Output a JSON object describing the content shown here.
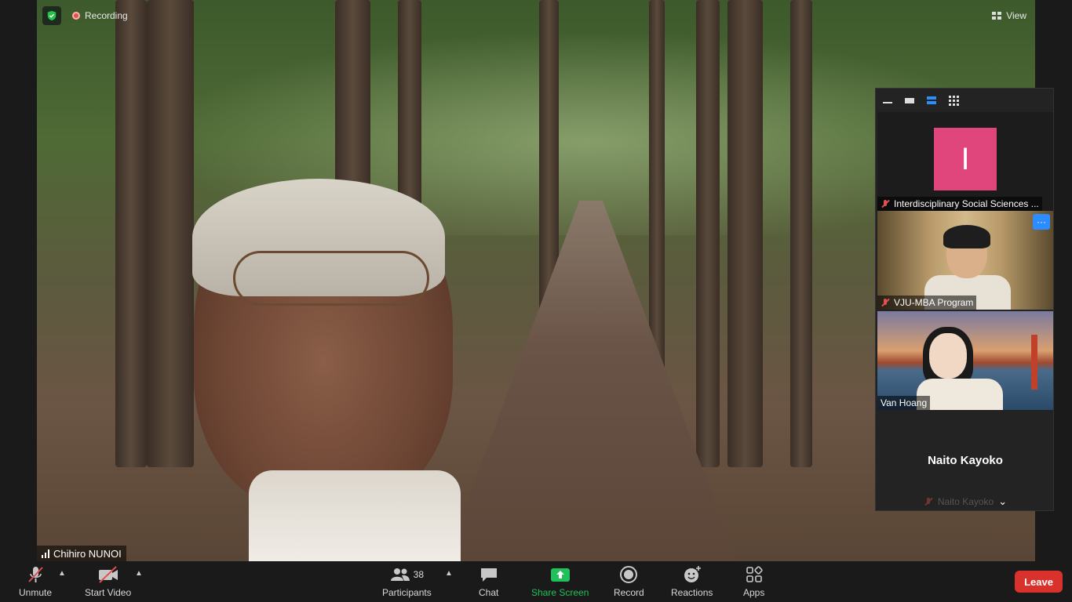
{
  "meeting": {
    "recording_label": "Recording",
    "view_label": "View",
    "speaker_name": "Chihiro NUNOI"
  },
  "panel": {
    "participants": [
      {
        "name": "Interdisciplinary Social Sciences ...",
        "avatar_letter": "I",
        "avatar_color": "#e0457b",
        "muted": true
      },
      {
        "name": "VJU-MBA Program",
        "muted": true
      },
      {
        "name": "Van Hoang",
        "muted": false
      },
      {
        "name": "Naito Kayoko",
        "muted": true
      }
    ]
  },
  "toolbar": {
    "unmute_label": "Unmute",
    "start_video_label": "Start Video",
    "participants_label": "Participants",
    "participants_count": "38",
    "chat_label": "Chat",
    "share_label": "Share Screen",
    "record_label": "Record",
    "reactions_label": "Reactions",
    "apps_label": "Apps",
    "leave_label": "Leave"
  },
  "colors": {
    "accent_green": "#21c05a",
    "leave_red": "#d9312b",
    "mute_red": "#e05050",
    "blue": "#2d8cff"
  }
}
